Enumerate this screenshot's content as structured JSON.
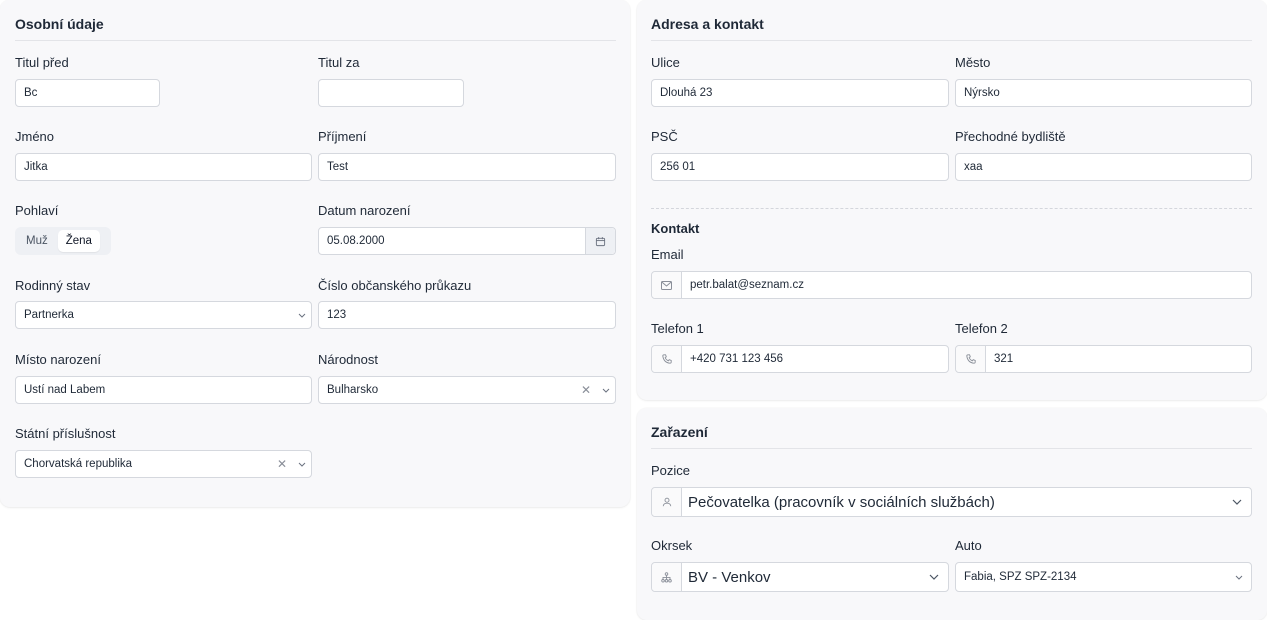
{
  "personal": {
    "title": "Osobní údaje",
    "title_before": {
      "label": "Titul před",
      "value": "Bc"
    },
    "title_after": {
      "label": "Titul za",
      "value": ""
    },
    "first_name": {
      "label": "Jméno",
      "value": "Jitka"
    },
    "last_name": {
      "label": "Příjmení",
      "value": "Test"
    },
    "gender": {
      "label": "Pohlaví",
      "options": [
        "Muž",
        "Žena"
      ],
      "selected": "Žena"
    },
    "birth_date": {
      "label": "Datum narození",
      "value": "05.08.2000"
    },
    "marital_status": {
      "label": "Rodinný stav",
      "value": "Partnerka"
    },
    "id_card": {
      "label": "Číslo občanského průkazu",
      "value": "123"
    },
    "birth_place": {
      "label": "Místo narození",
      "value": "Ústí nad Labem"
    },
    "nationality": {
      "label": "Národnost",
      "value": "Bulharsko"
    },
    "citizenship": {
      "label": "Státní příslušnost",
      "value": "Chorvatská republika"
    }
  },
  "address": {
    "title": "Adresa a kontakt",
    "street": {
      "label": "Ulice",
      "value": "Dlouhá 23"
    },
    "city": {
      "label": "Město",
      "value": "Nýrsko"
    },
    "zip": {
      "label": "PSČ",
      "value": "256 01"
    },
    "temp_residence": {
      "label": "Přechodné bydliště",
      "value": "xaa"
    },
    "contact_heading": "Kontakt",
    "email": {
      "label": "Email",
      "value": "petr.balat@seznam.cz"
    },
    "phone1": {
      "label": "Telefon 1",
      "value": "+420 731 123 456"
    },
    "phone2": {
      "label": "Telefon 2",
      "value": "321"
    }
  },
  "assignment": {
    "title": "Zařazení",
    "position": {
      "label": "Pozice",
      "value": "Pečovatelka (pracovník v sociálních službách)"
    },
    "district": {
      "label": "Okrsek",
      "value": "BV - Venkov"
    },
    "car": {
      "label": "Auto",
      "value": "Fabia, SPZ SPZ-2134"
    }
  },
  "icons": {
    "chevron": "chevron-down-icon",
    "clear": "clear-icon",
    "calendar": "calendar-icon",
    "mail": "mail-icon",
    "phone": "phone-icon",
    "user": "user-icon",
    "district": "network-icon"
  },
  "colors": {
    "card_bg": "#f8f8fa",
    "border": "#d5d8de",
    "text": "#1f2937",
    "muted": "#8a8f99"
  }
}
